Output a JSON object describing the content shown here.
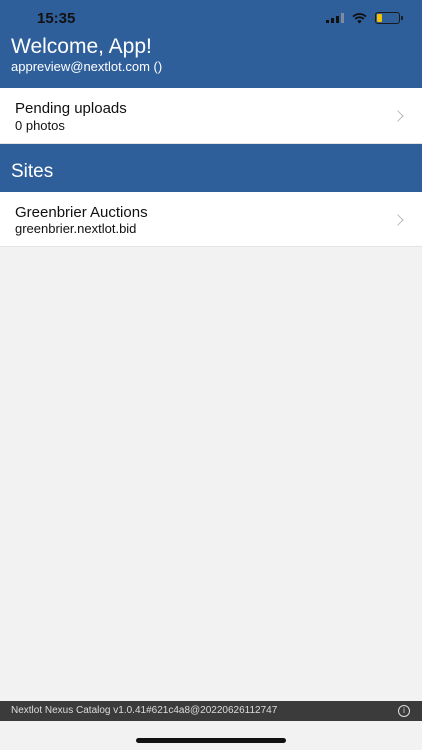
{
  "status_bar": {
    "time": "15:35",
    "icons": [
      "signal-icon",
      "wifi-icon",
      "battery-icon"
    ],
    "battery_color": "#f2c300"
  },
  "header": {
    "title": "Welcome, App!",
    "subtitle": "appreview@nextlot.com ()",
    "background": "#2f5f9b"
  },
  "pending": {
    "title": "Pending uploads",
    "subtitle": "0 photos"
  },
  "sites_section": {
    "title": "Sites"
  },
  "sites": [
    {
      "name": "Greenbrier Auctions",
      "domain": "greenbrier.nextlot.bid"
    }
  ],
  "footer": {
    "version": "Nextlot Nexus Catalog v1.0.41#621c4a8@20220626112747",
    "info_icon": "info-icon"
  }
}
